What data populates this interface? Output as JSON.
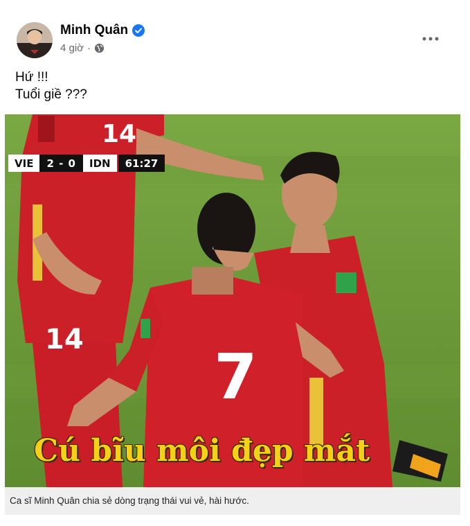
{
  "post": {
    "author_name": "Minh Quân",
    "time_ago": "4 giờ",
    "separator": "·",
    "verified": true,
    "privacy_icon": "globe-icon",
    "more_icon": "more-horizontal-icon",
    "text_lines": [
      "Hứ !!!",
      "Tuổi giề ???"
    ]
  },
  "media": {
    "scoreboard": {
      "home_team": "VIE",
      "score": "2 - 0",
      "away_team": "IDN",
      "match_time": "61:27"
    },
    "jersey_numbers": [
      "14",
      "14",
      "7"
    ],
    "meme_caption": "Cú bĩu môi đẹp mắt",
    "caption": "Ca sĩ Minh Quân chia sẻ dòng trạng thái vui vẻ, hài hước."
  },
  "colors": {
    "verified_blue": "#1877f2",
    "meta_gray": "#65676b",
    "pitch_green": "#6c9a3a",
    "jersey_red": "#d0202a",
    "caption_yellow": "#f4d116"
  }
}
